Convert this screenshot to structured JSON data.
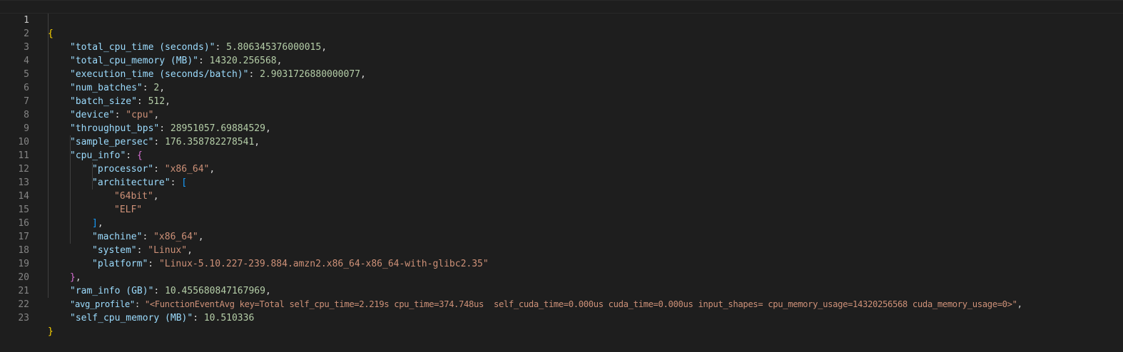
{
  "lines": [
    {
      "num": "1",
      "open": "{"
    },
    {
      "num": "2",
      "key": "\"total_cpu_time (seconds)\"",
      "sep": ": ",
      "val": "5.806345376000015",
      "end": ","
    },
    {
      "num": "3",
      "key": "\"total_cpu_memory (MB)\"",
      "sep": ": ",
      "val": "14320.256568",
      "end": ","
    },
    {
      "num": "4",
      "key": "\"execution_time (seconds/batch)\"",
      "sep": ": ",
      "val": "2.9031726880000077",
      "end": ","
    },
    {
      "num": "5",
      "key": "\"num_batches\"",
      "sep": ": ",
      "val": "2",
      "end": ","
    },
    {
      "num": "6",
      "key": "\"batch_size\"",
      "sep": ": ",
      "val": "512",
      "end": ","
    },
    {
      "num": "7",
      "key": "\"device\"",
      "sep": ": ",
      "val": "\"cpu\"",
      "end": ","
    },
    {
      "num": "8",
      "key": "\"throughput_bps\"",
      "sep": ": ",
      "val": "28951057.69884529",
      "end": ","
    },
    {
      "num": "9",
      "key": "\"sample_persec\"",
      "sep": ": ",
      "val": "176.358782278541",
      "end": ","
    },
    {
      "num": "10",
      "key": "\"cpu_info\"",
      "sep": ": ",
      "open": "{"
    },
    {
      "num": "11",
      "key": "\"processor\"",
      "sep": ": ",
      "val": "\"x86_64\"",
      "end": ","
    },
    {
      "num": "12",
      "key": "\"architecture\"",
      "sep": ": ",
      "open": "["
    },
    {
      "num": "13",
      "val": "\"64bit\"",
      "end": ","
    },
    {
      "num": "14",
      "val": "\"ELF\""
    },
    {
      "num": "15",
      "close": "]",
      "end": ","
    },
    {
      "num": "16",
      "key": "\"machine\"",
      "sep": ": ",
      "val": "\"x86_64\"",
      "end": ","
    },
    {
      "num": "17",
      "key": "\"system\"",
      "sep": ": ",
      "val": "\"Linux\"",
      "end": ","
    },
    {
      "num": "18",
      "key": "\"platform\"",
      "sep": ": ",
      "val": "\"Linux-5.10.227-239.884.amzn2.x86_64-x86_64-with-glibc2.35\""
    },
    {
      "num": "19",
      "close": "}",
      "end": ","
    },
    {
      "num": "20",
      "key": "\"ram_info (GB)\"",
      "sep": ": ",
      "val": "10.455680847167969",
      "end": ","
    },
    {
      "num": "21",
      "key": "\"avg_profile\"",
      "sep": ": ",
      "val": "\"<FunctionEventAvg key=Total self_cpu_time=2.219s cpu_time=374.748us  self_cuda_time=0.000us cuda_time=0.000us input_shapes= cpu_memory_usage=14320256568 cuda_memory_usage=0>\"",
      "end": ","
    },
    {
      "num": "22",
      "key": "\"self_cpu_memory (MB)\"",
      "sep": ": ",
      "val": "10.510336"
    },
    {
      "num": "23",
      "close": "}"
    }
  ],
  "colors": {
    "background": "#1e1e1e",
    "key": "#9cdcfe",
    "string": "#ce9178",
    "number": "#b5cea8",
    "bracket_level1": "#ffd700",
    "bracket_level2": "#da70d6",
    "bracket_level3": "#179fff"
  }
}
